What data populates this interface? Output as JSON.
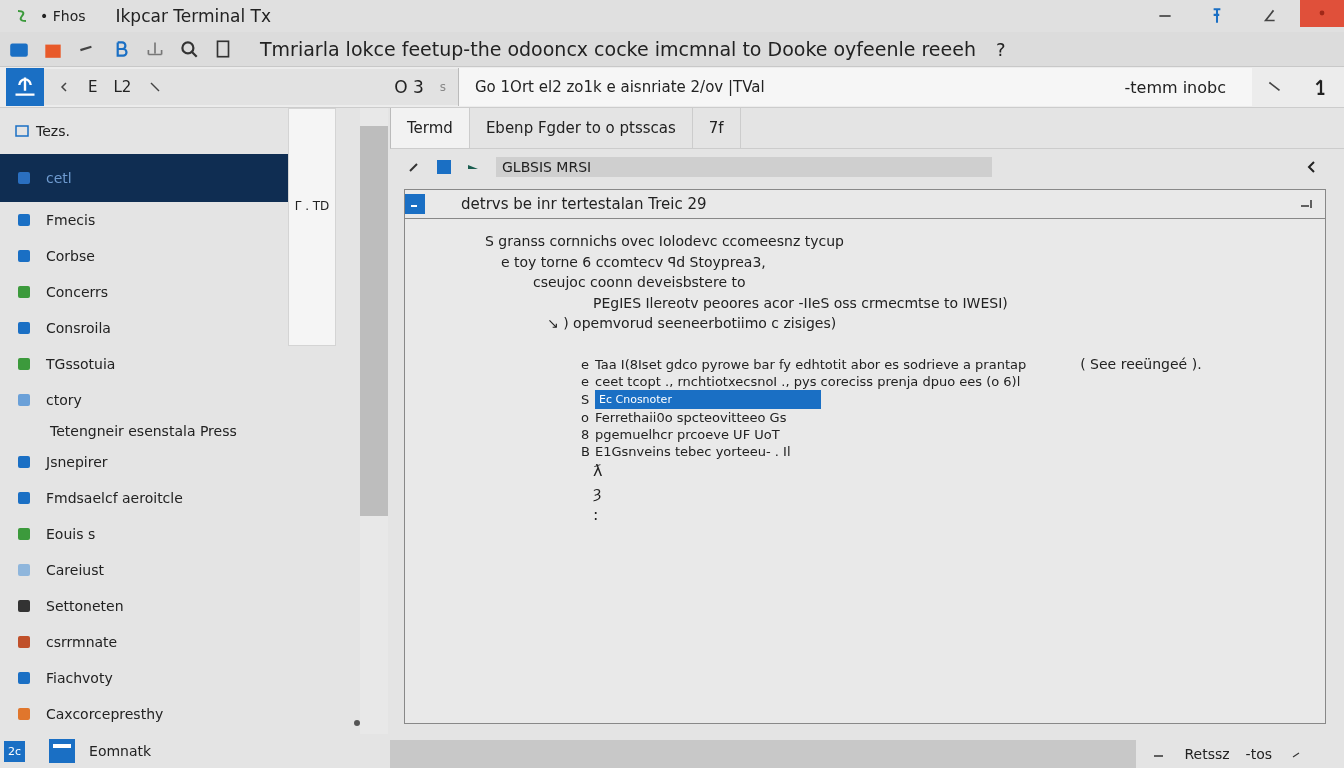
{
  "title_bar": {
    "app_label": "• Fhos",
    "title": "Ikpcar Terminal Tx"
  },
  "toolbar": {
    "heading": "Tmriarla lokce feetup-the odooncx cocke imcmnal to Dooke oyfeenle reeeh",
    "help": "?"
  },
  "nav_bar": {
    "labels": [
      "E",
      "L2"
    ],
    "counter": "O 3",
    "sep": "s",
    "address": "Go 1Ort el2 zo1k e aisnriate 2/ov |TVal",
    "search": "-temm inobc"
  },
  "sidebar": {
    "header": "Tezs.",
    "items": [
      {
        "label": "cetl",
        "selected": true
      },
      {
        "label": "Fmecis",
        "selected": false
      },
      {
        "label": "Corbse",
        "selected": false
      },
      {
        "label": "Concerrs",
        "selected": false
      },
      {
        "label": "Consroila",
        "selected": false
      },
      {
        "label": "TGssotuia",
        "selected": false
      },
      {
        "label": "ctory",
        "selected": false
      },
      {
        "label": "Tetengneir esenstala Press",
        "selected": false
      },
      {
        "label": "Jsnepirer",
        "selected": false
      },
      {
        "label": "Fmdsaelcf aeroitcle",
        "selected": false
      },
      {
        "label": "Eouis s",
        "selected": false
      },
      {
        "label": "Careiust",
        "selected": false
      },
      {
        "label": "Settoneten",
        "selected": false
      },
      {
        "label": "csrrmnate",
        "selected": false
      },
      {
        "label": "Fiachvoty",
        "selected": false
      },
      {
        "label": "Caxcorcepresthy",
        "selected": false
      }
    ],
    "footer_badge": "2c",
    "footer_label": "Eomnatk"
  },
  "mini_panel": {
    "text": "Γ . TD"
  },
  "tabs": [
    {
      "label": "Termd",
      "selected": true
    },
    {
      "label": "Ebenp Fgder to o ptsscas",
      "selected": false
    },
    {
      "label": "7f",
      "selected": false
    }
  ],
  "path_field": {
    "value": "GLBSIS MRSI"
  },
  "panel": {
    "title": "detrvs be inr tertestalan Treic 29",
    "lines_top": [
      "S granss cornnichs ovec Iolodevc ccomeesnz tycup",
      "e toy torne 6 ccomtecv ꟼd Stoyprea3,",
      "cseujoc coonn deveisbstere to",
      "PEgIES Ilereotv peoores acor -IIeS oss crmecmtse to IWESI)",
      "↘ )  opemvorud seeneerbotiimo c zisiges)"
    ],
    "note": "( See reeüngeé ).",
    "lines_list": [
      {
        "marker": "e",
        "text": "Taa I(8Iset gdco pyrowe bar fy edhtotit abor es sodrieve a prantap",
        "selected": false
      },
      {
        "marker": "e",
        "text": "ceet tcopt ., rnchtiotxecsnoI ., pys coreciss prenja dpuo ees (o 6)l",
        "selected": false
      },
      {
        "marker": "S",
        "text": "Ec Cnosnoter",
        "selected": true
      },
      {
        "marker": "o",
        "text": "Ferrethaii0o spcteovitteeo Gs",
        "selected": false
      },
      {
        "marker": "8",
        "text": "pgemuelhcr prcoeve UF UoT",
        "selected": false
      },
      {
        "marker": "B",
        "text": "E1Gsnveins tebec yorteeu- . Il",
        "selected": false
      }
    ],
    "trail": [
      "ƛ",
      "ȝ",
      ":"
    ]
  },
  "status_bar": {
    "items": [
      "Retssz",
      "-tos"
    ]
  }
}
